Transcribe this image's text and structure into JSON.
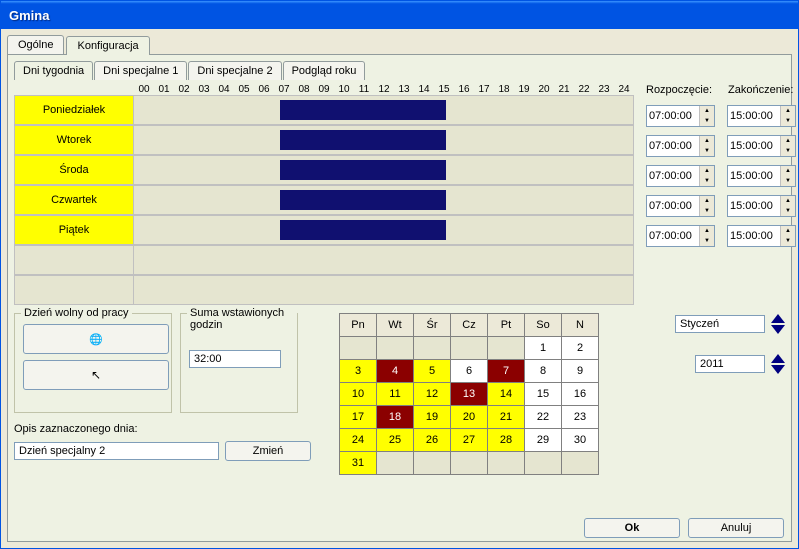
{
  "window_title": "Gmina",
  "tabs": {
    "general": "Ogólne",
    "config": "Konfiguracja"
  },
  "inner_tabs": {
    "weekdays": "Dni tygodnia",
    "special1": "Dni specjalne 1",
    "special2": "Dni specjalne 2",
    "year": "Podgląd roku"
  },
  "hours": [
    "00",
    "01",
    "02",
    "03",
    "04",
    "05",
    "06",
    "07",
    "08",
    "09",
    "10",
    "11",
    "12",
    "13",
    "14",
    "15",
    "16",
    "17",
    "18",
    "19",
    "20",
    "21",
    "22",
    "23",
    "24"
  ],
  "days": [
    "Poniedziałek",
    "Wtorek",
    "Środa",
    "Czwartek",
    "Piątek"
  ],
  "time_headers": {
    "start": "Rozpoczęcie:",
    "end": "Zakończenie:"
  },
  "day_times": [
    {
      "start": "07:00:00",
      "end": "15:00:00"
    },
    {
      "start": "07:00:00",
      "end": "15:00:00"
    },
    {
      "start": "07:00:00",
      "end": "15:00:00"
    },
    {
      "start": "07:00:00",
      "end": "15:00:00"
    },
    {
      "start": "07:00:00",
      "end": "15:00:00"
    }
  ],
  "free_day": {
    "title": "Dzień wolny od pracy"
  },
  "hours_sum": {
    "title": "Suma wstawionych godzin",
    "value": "32:00"
  },
  "desc": {
    "label": "Opis zaznaczonego dnia:",
    "value": "Dzień specjalny 2",
    "change": "Zmień"
  },
  "calendar": {
    "headers": [
      "Pn",
      "Wt",
      "Śr",
      "Cz",
      "Pt",
      "So",
      "N"
    ],
    "cells": [
      [
        "",
        "",
        "",
        "",
        "",
        "1",
        "2"
      ],
      [
        "3",
        "4",
        "5",
        "6",
        "7",
        "8",
        "9"
      ],
      [
        "10",
        "11",
        "12",
        "13",
        "14",
        "15",
        "16"
      ],
      [
        "17",
        "18",
        "19",
        "20",
        "21",
        "22",
        "23"
      ],
      [
        "24",
        "25",
        "26",
        "27",
        "28",
        "29",
        "30"
      ],
      [
        "31",
        "",
        "",
        "",
        "",
        "",
        ""
      ]
    ],
    "classes": [
      [
        "empty",
        "empty",
        "empty",
        "empty",
        "empty",
        "white",
        "white"
      ],
      [
        "yellow",
        "red",
        "yellow",
        "white",
        "red",
        "white",
        "white"
      ],
      [
        "yellow",
        "yellow",
        "yellow",
        "red",
        "yellow",
        "white",
        "white"
      ],
      [
        "yellow",
        "red",
        "yellow",
        "yellow",
        "yellow",
        "white",
        "white"
      ],
      [
        "yellow",
        "yellow",
        "yellow",
        "yellow",
        "yellow",
        "white",
        "white"
      ],
      [
        "yellow",
        "empty",
        "empty",
        "empty",
        "empty",
        "empty",
        "empty"
      ]
    ]
  },
  "month": "Styczeń",
  "year": "2011",
  "buttons": {
    "ok": "Ok",
    "cancel": "Anuluj"
  }
}
